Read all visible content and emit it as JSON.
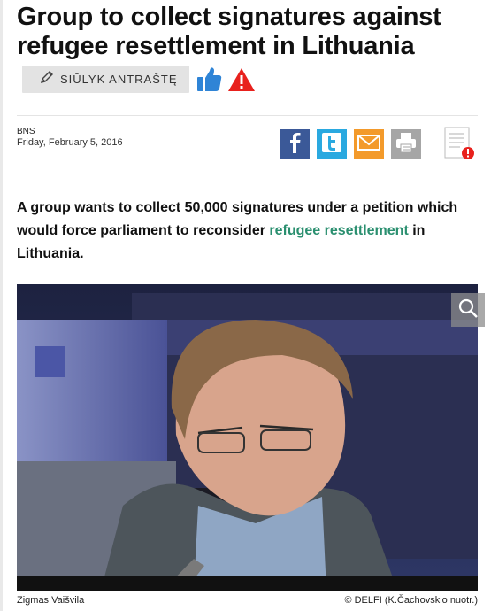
{
  "article": {
    "title": "Group to collect signatures against refugee resettlement in Lithuania",
    "suggest_button_label": "SIŪLYK ANTRAŠTĘ",
    "source": "BNS",
    "date": "Friday, February 5, 2016",
    "lead_before": "A group wants to collect 50,000 signatures under a petition which would force parliament to reconsider ",
    "lead_link": "refugee resettlement",
    "lead_after": " in Lithuania.",
    "photo_caption": "Zigmas Vaišvila",
    "photo_credit": "© DELFI (K.Čachovskio nuotr.)"
  },
  "icons": {
    "suggest": "pencil-icon",
    "like": "thumbs-up-icon",
    "report": "warning-icon",
    "share": [
      "facebook-icon",
      "twitter-icon",
      "email-icon",
      "print-icon"
    ],
    "report_error": "report-error-icon",
    "zoom": "zoom-icon"
  },
  "colors": {
    "facebook": "#3b5998",
    "twitter": "#2aa9e0",
    "email": "#f39a2b",
    "print": "#a6a6a6",
    "link": "#2a8f6f",
    "like": "#2f84d6",
    "warning": "#e8211d"
  }
}
